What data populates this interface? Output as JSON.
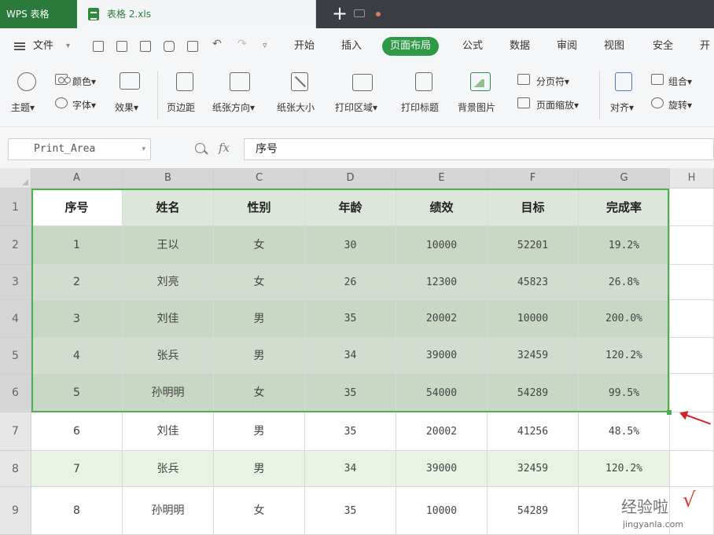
{
  "titlebar": {
    "app_name": "WPS 表格",
    "doc_tab": "表格 2.xls",
    "new_tab": "+"
  },
  "menubar": {
    "file": "文件",
    "tabs": [
      {
        "label": "开始",
        "active": false
      },
      {
        "label": "插入",
        "active": false
      },
      {
        "label": "页面布局",
        "active": true
      },
      {
        "label": "公式",
        "active": false
      },
      {
        "label": "数据",
        "active": false
      },
      {
        "label": "审阅",
        "active": false
      },
      {
        "label": "视图",
        "active": false
      },
      {
        "label": "安全",
        "active": false
      },
      {
        "label": "开",
        "active": false
      }
    ]
  },
  "ribbon": {
    "theme": "主题",
    "colors": "颜色",
    "fonts": "字体",
    "effects": "效果",
    "margins": "页边距",
    "orientation": "纸张方向",
    "size": "纸张大小",
    "print_area": "打印区域",
    "print_titles": "打印标题",
    "background": "背景图片",
    "page_break": "分页符",
    "page_scale": "页面缩放",
    "align": "对齐",
    "group": "组合",
    "rotate": "旋转"
  },
  "formula_bar": {
    "name_box": "Print_Area",
    "fx": "fx",
    "content": "序号"
  },
  "sheet": {
    "columns": [
      "A",
      "B",
      "C",
      "D",
      "E",
      "F",
      "G",
      "H"
    ],
    "row_numbers": [
      "1",
      "2",
      "3",
      "4",
      "5",
      "6",
      "7",
      "8",
      "9"
    ],
    "header": [
      "序号",
      "姓名",
      "性别",
      "年龄",
      "绩效",
      "目标",
      "完成率"
    ],
    "rows": [
      [
        "1",
        "王以",
        "女",
        "30",
        "10000",
        "52201",
        "19.2%"
      ],
      [
        "2",
        "刘亮",
        "女",
        "26",
        "12300",
        "45823",
        "26.8%"
      ],
      [
        "3",
        "刘佳",
        "男",
        "35",
        "20002",
        "10000",
        "200.0%"
      ],
      [
        "4",
        "张兵",
        "男",
        "34",
        "39000",
        "32459",
        "120.2%"
      ],
      [
        "5",
        "孙明明",
        "女",
        "35",
        "54000",
        "54289",
        "99.5%"
      ],
      [
        "6",
        "刘佳",
        "男",
        "35",
        "20002",
        "41256",
        "48.5%"
      ],
      [
        "7",
        "张兵",
        "男",
        "34",
        "39000",
        "32459",
        "120.2%"
      ],
      [
        "8",
        "孙明明",
        "女",
        "35",
        "10000",
        "54289",
        ""
      ]
    ],
    "print_area": "A1:G6"
  },
  "watermark": {
    "brand": "经验啦",
    "check": "√",
    "url": "jingyanla.com"
  },
  "colors": {
    "accent": "#2e9a46",
    "selection_fill": "#c8d8c4",
    "selection_border": "#4caf50",
    "alt_row": "#e8f3e4",
    "arrow": "#d3262a"
  }
}
